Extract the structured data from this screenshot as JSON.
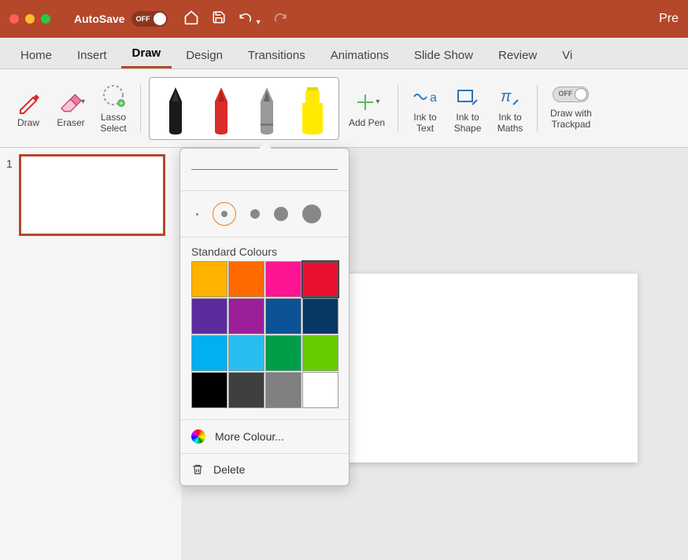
{
  "titlebar": {
    "autosave_label": "AutoSave",
    "autosave_state": "OFF",
    "app_title": "Pre"
  },
  "tabs": [
    "Home",
    "Insert",
    "Draw",
    "Design",
    "Transitions",
    "Animations",
    "Slide Show",
    "Review",
    "Vi"
  ],
  "active_tab": "Draw",
  "ribbon": {
    "draw": "Draw",
    "eraser": "Eraser",
    "lasso": "Lasso\nSelect",
    "add_pen": "Add Pen",
    "ink_to_text": "Ink to\nText",
    "ink_to_shape": "Ink to\nShape",
    "ink_to_maths": "Ink to\nMaths",
    "draw_trackpad": "Draw with\nTrackpad",
    "trackpad_state": "OFF",
    "pens": [
      {
        "name": "pen-black",
        "color": "#000000",
        "type": "pen"
      },
      {
        "name": "pen-red",
        "color": "#D92B2B",
        "type": "pen"
      },
      {
        "name": "pencil-gray",
        "color": "#888888",
        "type": "pencil"
      },
      {
        "name": "highlighter-yellow",
        "color": "#FFEB00",
        "type": "highlighter"
      }
    ]
  },
  "slide_panel": {
    "slide_num": "1"
  },
  "dropdown": {
    "thickness_sizes": [
      3,
      8,
      12,
      18,
      24
    ],
    "thickness_selected": 1,
    "header": "Standard Colours",
    "colors": [
      "#FFB300",
      "#FF6A00",
      "#FF1493",
      "#E8102E",
      "#5B2C9E",
      "#9B1F9B",
      "#0B5394",
      "#073763",
      "#00B0F0",
      "#29BDEF",
      "#009E49",
      "#66CC00",
      "#000000",
      "#3F3F3F",
      "#808080",
      "#FFFFFF"
    ],
    "selected_color_index": 3,
    "more_colours": "More Colour...",
    "delete": "Delete"
  }
}
